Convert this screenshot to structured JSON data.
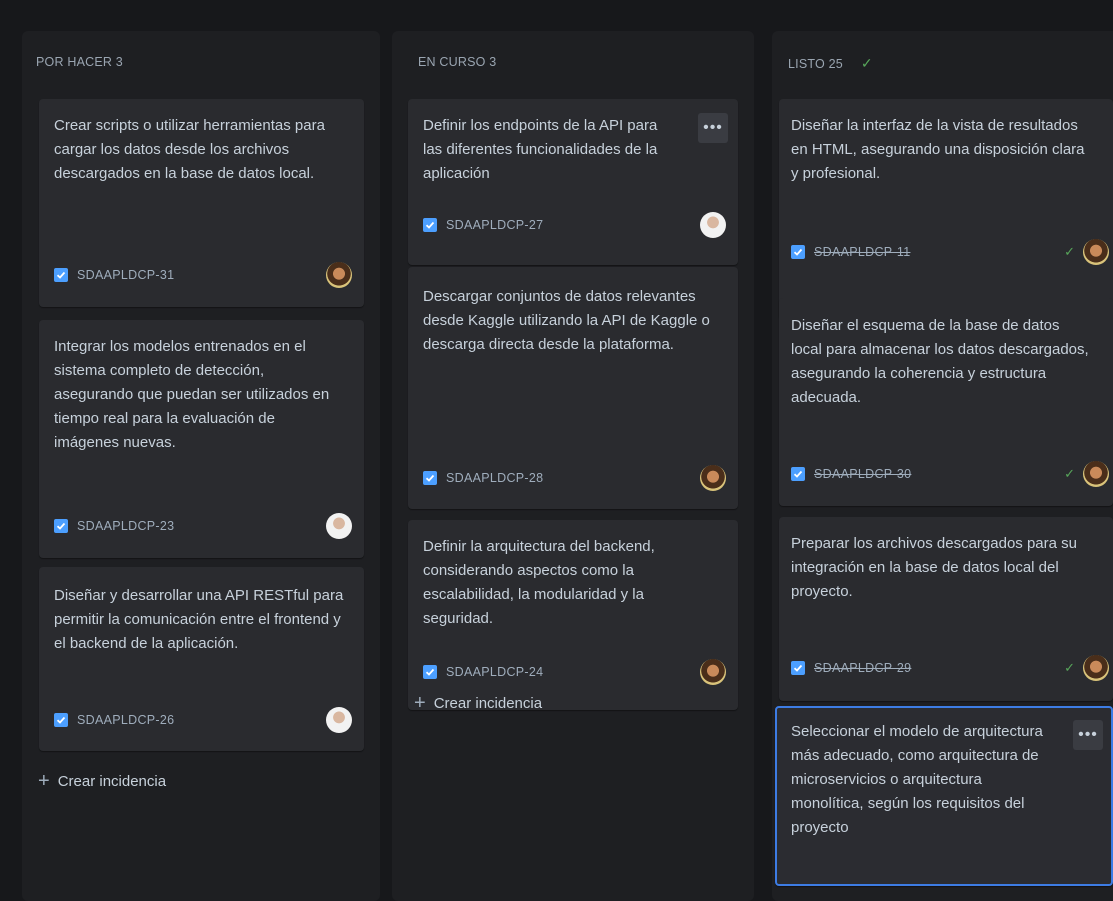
{
  "columns": [
    {
      "title": "POR HACER 3",
      "cards": [
        {
          "title": "Crear scripts o utilizar herramientas para cargar los datos desde los archivos descargados en la base de datos local.",
          "key": "SDAAPLDCP-31"
        },
        {
          "title": "Integrar los modelos entrenados en el sistema completo de detección, asegurando que puedan ser utilizados en tiempo real para la evaluación de imágenes nuevas.",
          "key": "SDAAPLDCP-23"
        },
        {
          "title": "Diseñar y desarrollar una API RESTful para permitir la comunicación entre el frontend y el backend de la aplicación.",
          "key": "SDAAPLDCP-26"
        }
      ],
      "create_label": "Crear incidencia"
    },
    {
      "title": "EN CURSO 3",
      "cards": [
        {
          "title": "Definir los endpoints de la API para las diferentes funcionalidades de la aplicación",
          "key": "SDAAPLDCP-27",
          "menu": "•••"
        },
        {
          "title": "Descargar conjuntos de datos relevantes desde Kaggle utilizando la API de Kaggle o descarga directa desde la plataforma.",
          "key": "SDAAPLDCP-28"
        },
        {
          "title": "Definir la arquitectura del backend, considerando aspectos como la escalabilidad, la modularidad y la seguridad.",
          "key": "SDAAPLDCP-24"
        }
      ],
      "create_label": "Crear incidencia"
    },
    {
      "title": "LISTO 25",
      "title_icon": "check-icon",
      "cards": [
        {
          "title": "Diseñar la interfaz de la vista de resultados en HTML, asegurando una disposición clara y profesional.",
          "key": "SDAAPLDCP-11"
        },
        {
          "title": "Diseñar el esquema de la base de datos local para almacenar los datos descargados, asegurando la coherencia y estructura adecuada.",
          "key": "SDAAPLDCP-30"
        },
        {
          "title": "Preparar los archivos descargados para su integración en la base de datos local del proyecto.",
          "key": "SDAAPLDCP-29"
        },
        {
          "title": "Seleccionar el modelo de arquitectura más adecuado, como arquitectura de microservicios o arquitectura monolítica, según los requisitos del proyecto",
          "menu": "•••"
        }
      ]
    }
  ],
  "icons": {
    "card_type": "checkbox-task-icon",
    "done": "check-icon",
    "create": "plus-icon"
  },
  "colors": {
    "background": "#17181b",
    "column": "#1e1f22",
    "card": "#2a2b2f",
    "accent": "#4c9fff",
    "done": "#57a55a",
    "selected_border": "#3d7ce4"
  }
}
